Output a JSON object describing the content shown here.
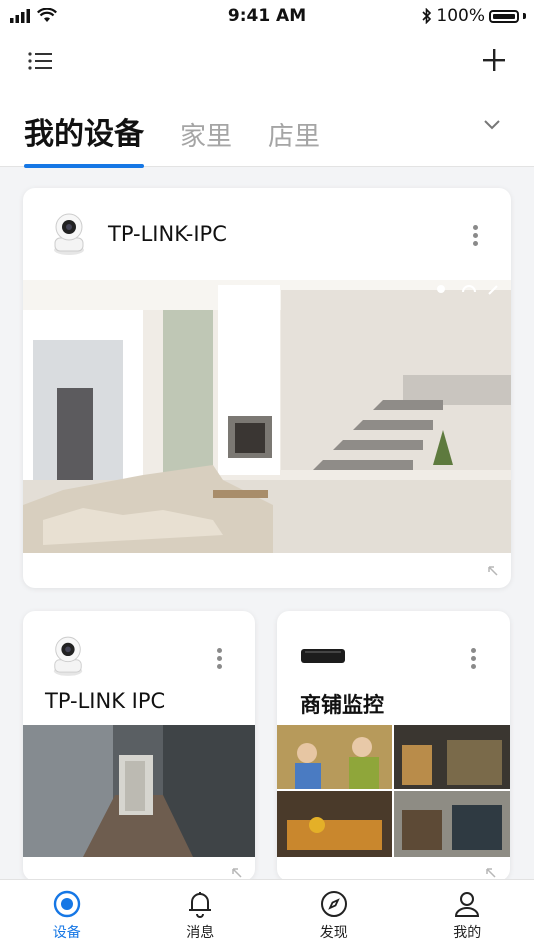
{
  "status": {
    "time": "9:41 AM",
    "battery": "100%"
  },
  "tabs": [
    {
      "label": "我的设备"
    },
    {
      "label": "家里"
    },
    {
      "label": "店里"
    }
  ],
  "devices": [
    {
      "name": "TP-LINK-IPC"
    },
    {
      "name": "TP-LINK IPC"
    },
    {
      "name": "商铺监控"
    }
  ],
  "tabbar": [
    {
      "label": "设备"
    },
    {
      "label": "消息"
    },
    {
      "label": "发现"
    },
    {
      "label": "我的"
    }
  ],
  "colors": {
    "accent": "#1677e5"
  },
  "icons": [
    "menu-icon",
    "plus-icon",
    "chevron-down-icon",
    "camera-icon",
    "nvr-icon",
    "more-icon",
    "expand-icon",
    "cloud-icon",
    "wifi-icon",
    "mute-icon",
    "devices-icon",
    "bell-icon",
    "compass-icon",
    "person-icon"
  ]
}
